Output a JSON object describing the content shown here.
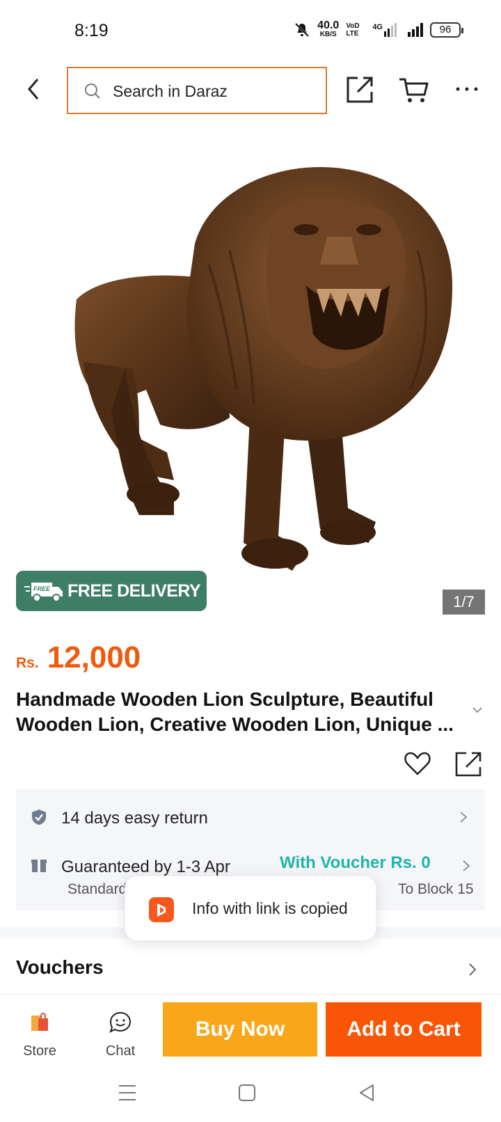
{
  "status_bar": {
    "time": "8:19",
    "net_speed": "40.0",
    "net_unit": "KB/S",
    "vo_lte": "VoD LTE",
    "network": "4G",
    "battery": "96"
  },
  "header": {
    "search_placeholder": "Search in Daraz",
    "accent": "#e0782c"
  },
  "product": {
    "badge_free_delivery": "FREE DELIVERY",
    "badge_free_small": "FREE",
    "image_counter": "1/7",
    "currency": "Rs.",
    "price": "12,000",
    "title": "Handmade Wooden Lion Sculpture, Beautiful Wooden Lion, Creative Wooden Lion, Unique ..."
  },
  "info": {
    "return_text": "14 days easy return",
    "guarantee_text": "Guaranteed by 1-3 Apr",
    "voucher_text": "With Voucher Rs. 0",
    "standard_text": "Standard",
    "block_text": "To Block 15"
  },
  "toast": {
    "message": "Info with link is copied"
  },
  "vouchers": {
    "label": "Vouchers"
  },
  "bottom": {
    "store": "Store",
    "chat": "Chat",
    "buy_now": "Buy Now",
    "add_to_cart": "Add to Cart",
    "buy_color": "#f9a61a",
    "cart_color": "#f85606"
  }
}
